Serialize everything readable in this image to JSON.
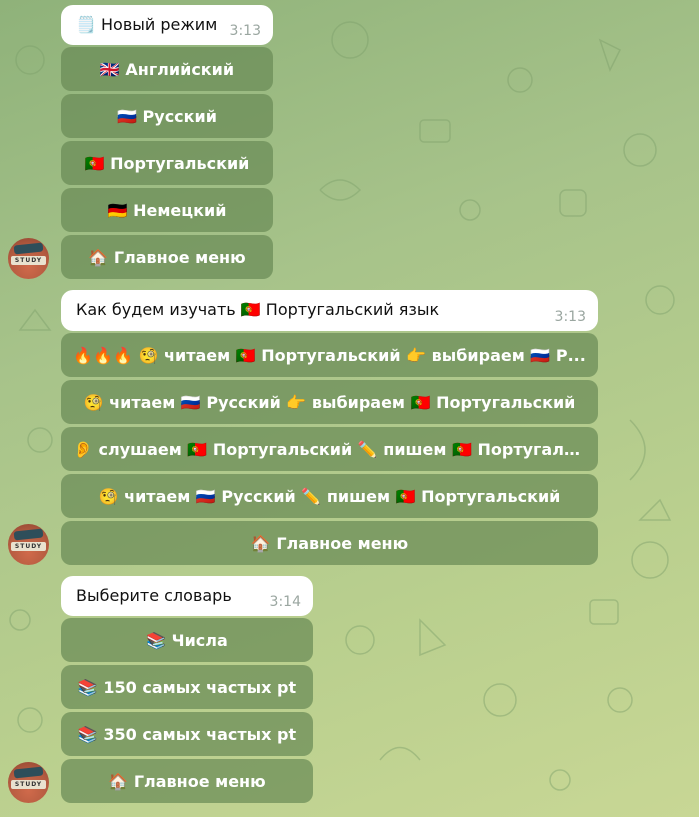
{
  "messages": [
    {
      "text": "🗒️ Новый режим",
      "time": "3:13",
      "buttons": [
        "🇬🇧 Английский",
        "🇷🇺 Русский",
        "🇵🇹 Португальский",
        "🇩🇪 Немецкий",
        "🏠 Главное меню"
      ]
    },
    {
      "text": "Как будем изучать 🇵🇹 Португальский язык",
      "time": "3:13",
      "buttons": [
        "🔥🔥🔥 🧐 читаем 🇵🇹 Португальский 👉 выбираем 🇷🇺 Р...",
        "🧐 читаем 🇷🇺 Русский 👉 выбираем 🇵🇹 Португальский",
        "👂 слушаем 🇵🇹 Португальский ✏️ пишем 🇵🇹 Португальск...",
        "🧐 читаем 🇷🇺 Русский ✏️ пишем 🇵🇹 Португальский",
        "🏠 Главное меню"
      ]
    },
    {
      "text": "Выберите словарь",
      "time": "3:14",
      "buttons": [
        "📚 Числа",
        "📚 150 самых частых pt",
        "📚 350 самых частых pt",
        "🏠 Главное меню"
      ]
    }
  ],
  "avatar_text": "STUDY"
}
